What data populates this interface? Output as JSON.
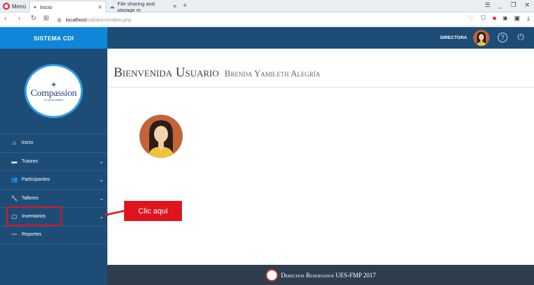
{
  "browser": {
    "menu_label": "Menú",
    "tabs": [
      {
        "label": "Inicio"
      },
      {
        "label": "File sharing and storage m"
      }
    ],
    "url_host": "localhost",
    "url_path": "/cdi/docs/index.php"
  },
  "app": {
    "brand": "SISTEMA CDI",
    "logo_text": "Compassion",
    "logo_tagline": "En Jesús nombre",
    "role": "DIRECTORA",
    "welcome_title": "Bienvenida Usuario",
    "welcome_user": "Brenda Yamileth Alegría",
    "footer": "Derechos Reservados UES-FMP 2017"
  },
  "sidebar": {
    "items": [
      {
        "label": "Inicio",
        "icon": "home-icon",
        "has_children": false
      },
      {
        "label": "Tutores",
        "icon": "briefcase-icon",
        "has_children": true
      },
      {
        "label": "Participantes",
        "icon": "people-icon",
        "has_children": true
      },
      {
        "label": "Talleres",
        "icon": "wrench-icon",
        "has_children": true
      },
      {
        "label": "Inventarios",
        "icon": "clipboard-icon",
        "has_children": true
      },
      {
        "label": "Reportes",
        "icon": "chart-line-icon",
        "has_children": false
      }
    ]
  },
  "annotation": {
    "callout_text": "Clic aqui",
    "color": "#e0141e"
  },
  "colors": {
    "sidebar": "#1d4d77",
    "brand_header": "#0f86d8",
    "footer": "#2f3e4f"
  }
}
